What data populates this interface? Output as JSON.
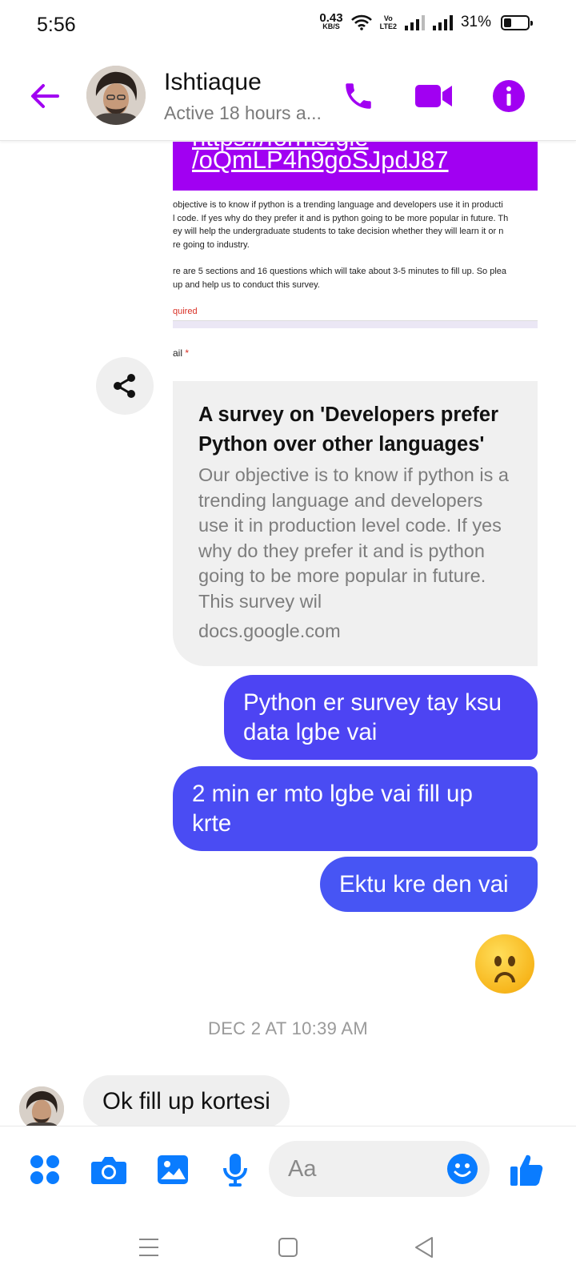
{
  "status_bar": {
    "time": "5:56",
    "net_speed": "0.43",
    "net_unit": "KB/S",
    "volte_line1": "Vo",
    "volte_line2": "LTE2",
    "battery": "31%"
  },
  "header": {
    "name": "Ishtiaque",
    "status": "Active 18 hours a...",
    "accent_color": "#a100f2"
  },
  "messages": {
    "shared_image": {
      "banner_line1": "https://forms.gle",
      "banner_line2": "/oQmLP4h9goSJpdJ87",
      "form_paragraph1": [
        " objective is to know if python is a trending language and developers use it in producti",
        "l code. If yes why do they prefer it and is python going to be more popular in future. Th",
        "ey will help the undergraduate students to take decision whether they will learn it or n",
        "re going to industry."
      ],
      "form_paragraph2": [
        "re are 5 sections and 16 questions which will take about 3-5 minutes to fill up. So plea",
        " up and help us to conduct this survey."
      ],
      "form_required": "quired",
      "form_email": "ail",
      "required_mark": "*"
    },
    "link_preview": {
      "title": "A survey on 'Developers prefer Python over other languages'",
      "description": "Our objective is to know if python is a trending language and developers use it in production level code. If yes why do they prefer it and is python going to be more popular in future. This survey wil",
      "domain": "docs.google.com"
    },
    "outgoing": [
      "Python er survey tay ksu data lgbe vai",
      "2 min er mto lgbe vai fill up krte",
      "Ektu kre den vai"
    ],
    "reaction_emoji": "frowning-face",
    "timestamp": "DEC 2 AT 10:39 AM",
    "incoming": "Ok fill up kortesi"
  },
  "composer": {
    "placeholder": "Aa",
    "accent_color": "#0a7cff"
  },
  "colors": {
    "bubble_out": "#4a4cf3",
    "bubble_in": "#efefef"
  }
}
